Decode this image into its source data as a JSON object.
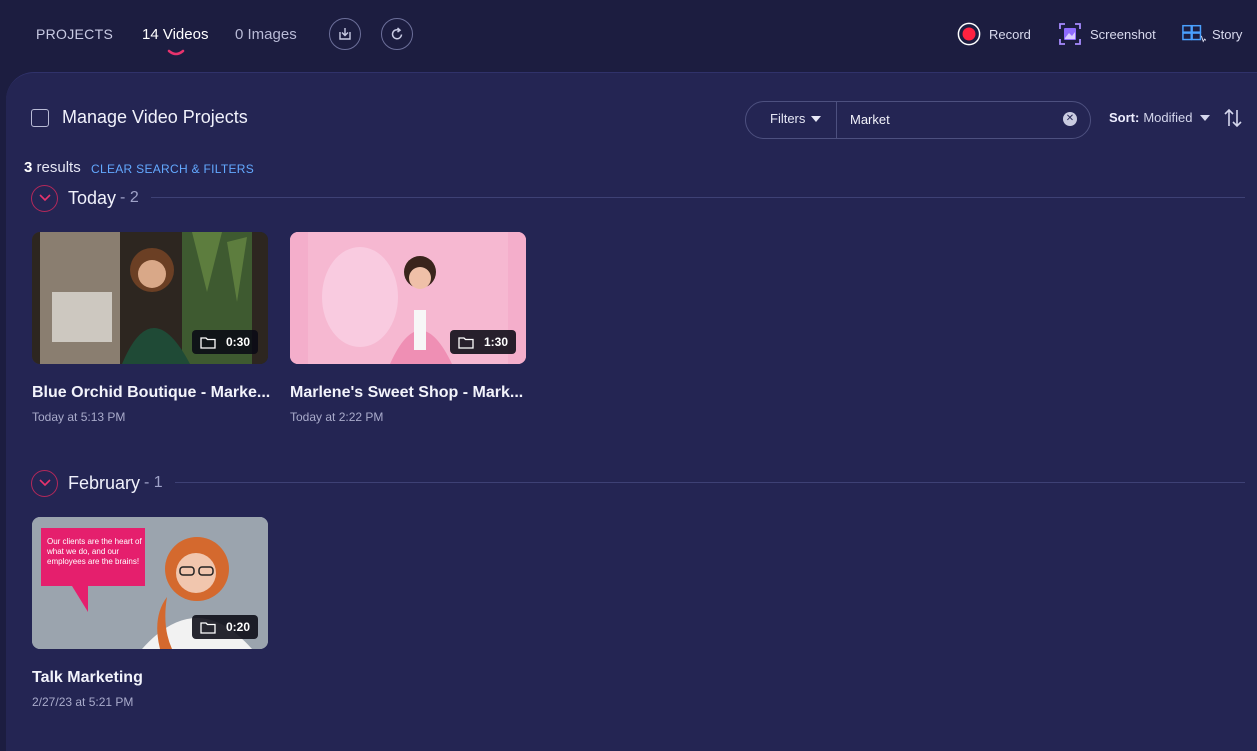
{
  "header": {
    "projects_label": "PROJECTS",
    "tab_videos": "14 Videos",
    "tab_images": "0 Images",
    "record_label": "Record",
    "screenshot_label": "Screenshot",
    "story_label": "Story"
  },
  "toolbar": {
    "manage_label": "Manage Video Projects",
    "filters_label": "Filters",
    "search_value": "Market",
    "sort_label": "Sort:",
    "sort_value": "Modified"
  },
  "results": {
    "count": "3",
    "label": "results",
    "clear_label": "CLEAR SEARCH & FILTERS"
  },
  "groups": [
    {
      "title": "Today",
      "count": "- 2",
      "items": [
        {
          "title": "Blue Orchid Boutique - Marke...",
          "date": "Today at 5:13 PM",
          "duration": "0:30"
        },
        {
          "title": "Marlene's Sweet Shop - Mark...",
          "date": "Today at 2:22 PM",
          "duration": "1:30"
        }
      ]
    },
    {
      "title": "February",
      "count": "- 1",
      "items": [
        {
          "title": "Talk Marketing",
          "date": "2/27/23 at 5:21 PM",
          "duration": "0:20",
          "overlay_text": "Our clients are the heart of what we do, and our employees are the brains!"
        }
      ]
    }
  ],
  "colors": {
    "background": "#1c1d40",
    "panel": "#242553",
    "accent_pink": "#e8336d",
    "link_blue": "#63a9ff",
    "record_red": "#ff2240"
  }
}
